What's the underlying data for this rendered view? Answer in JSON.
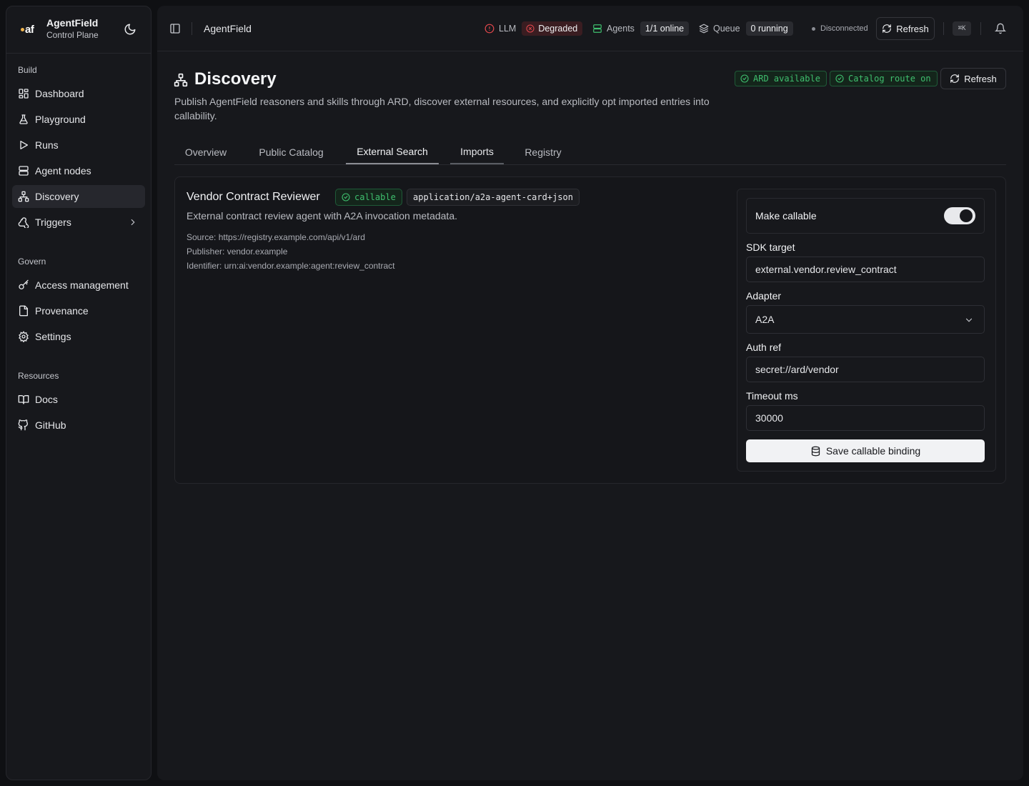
{
  "brand": {
    "logo_text": "af",
    "title": "AgentField",
    "subtitle": "Control Plane"
  },
  "sidebar": {
    "sections": [
      {
        "label": "Build",
        "items": [
          {
            "label": "Dashboard",
            "icon": "dashboard-icon"
          },
          {
            "label": "Playground",
            "icon": "flask-icon"
          },
          {
            "label": "Runs",
            "icon": "play-icon"
          },
          {
            "label": "Agent nodes",
            "icon": "server-icon"
          },
          {
            "label": "Discovery",
            "icon": "network-icon",
            "active": true
          },
          {
            "label": "Triggers",
            "icon": "webhook-icon",
            "expandable": true
          }
        ]
      },
      {
        "label": "Govern",
        "items": [
          {
            "label": "Access management",
            "icon": "key-icon"
          },
          {
            "label": "Provenance",
            "icon": "document-icon"
          },
          {
            "label": "Settings",
            "icon": "gear-icon"
          }
        ]
      },
      {
        "label": "Resources",
        "items": [
          {
            "label": "Docs",
            "icon": "book-icon"
          },
          {
            "label": "GitHub",
            "icon": "github-icon"
          }
        ]
      }
    ]
  },
  "topbar": {
    "title": "AgentField",
    "llm": {
      "label": "LLM",
      "status": "Degraded"
    },
    "agents": {
      "label": "Agents",
      "value": "1/1 online"
    },
    "queue": {
      "label": "Queue",
      "value": "0 running"
    },
    "connection": "Disconnected",
    "refresh_label": "Refresh",
    "shortcut": "⌘K"
  },
  "page": {
    "title": "Discovery",
    "description": "Publish AgentField reasoners and skills through ARD, discover external resources, and explicitly opt imported entries into callability.",
    "badges": [
      "ARD available",
      "Catalog route on"
    ],
    "refresh_label": "Refresh",
    "tabs": [
      {
        "label": "Overview"
      },
      {
        "label": "Public Catalog"
      },
      {
        "label": "External Search",
        "active": true
      },
      {
        "label": "Imports"
      },
      {
        "label": "Registry"
      }
    ]
  },
  "entry": {
    "name": "Vendor Contract Reviewer",
    "status_badge": "callable",
    "media_type": "application/a2a-agent-card+json",
    "description": "External contract review agent with A2A invocation metadata.",
    "source": "Source: https://registry.example.com/api/v1/ard",
    "publisher": "Publisher: vendor.example",
    "identifier": "Identifier: urn:ai:vendor.example:agent:review_contract"
  },
  "binding_form": {
    "make_callable_label": "Make callable",
    "make_callable": true,
    "sdk_target_label": "SDK target",
    "sdk_target": "external.vendor.review_contract",
    "adapter_label": "Adapter",
    "adapter": "A2A",
    "auth_ref_label": "Auth ref",
    "auth_ref": "secret://ard/vendor",
    "timeout_label": "Timeout ms",
    "timeout": "30000",
    "save_label": "Save callable binding"
  },
  "colors": {
    "background": "#0f1013",
    "panel": "#17181c",
    "success": "#3fbf6e",
    "danger": "#e5484d",
    "primary_button": "#f1f2f4"
  }
}
